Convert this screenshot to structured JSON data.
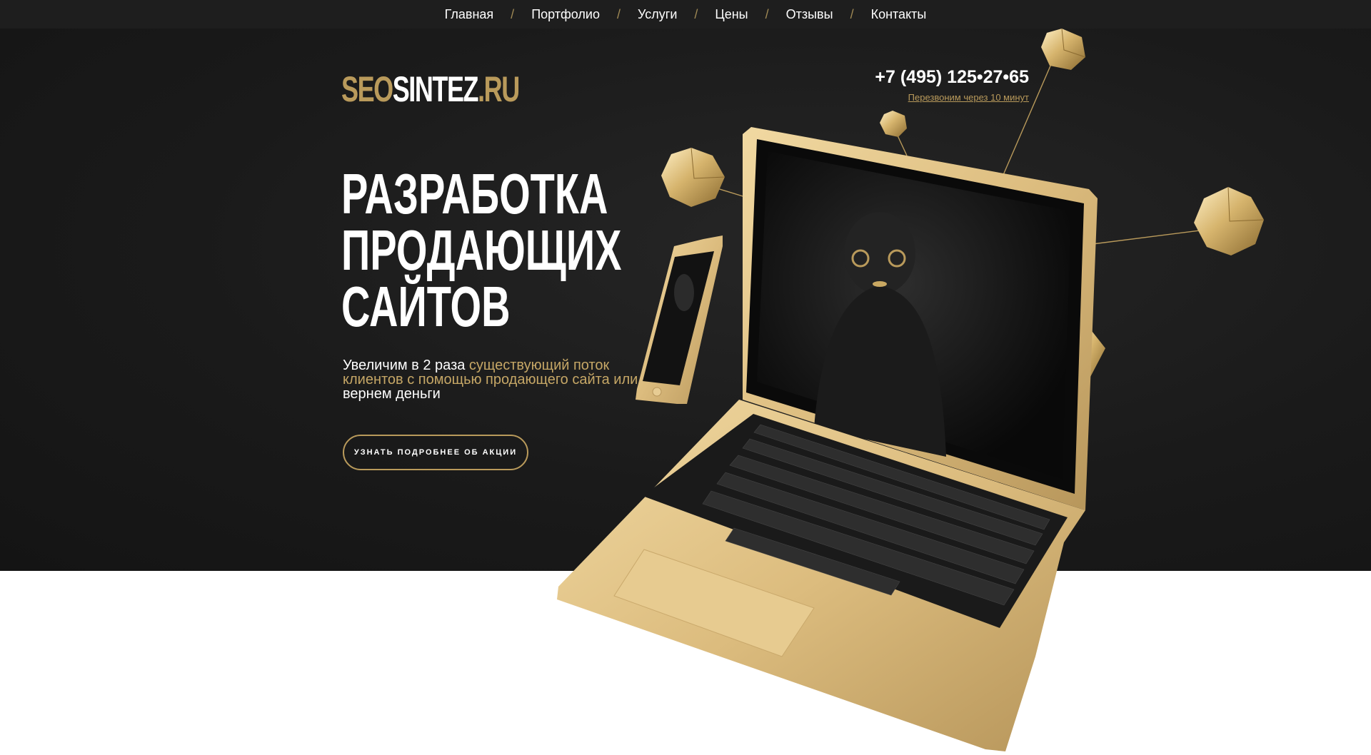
{
  "nav": {
    "items": [
      "Главная",
      "Портфолио",
      "Услуги",
      "Цены",
      "Отзывы",
      "Контакты"
    ],
    "separator": "/"
  },
  "logo": {
    "part1": "SEO",
    "part2": "SINTEZ",
    "part3": ".RU"
  },
  "contact": {
    "phone": "+7 (495) 125•27•65",
    "callback": "Перезвоним через 10 минут"
  },
  "hero": {
    "headline": [
      "РАЗРАБОТКА",
      "ПРОДАЮЩИХ",
      "САЙТОВ"
    ],
    "sub": {
      "s1": "Увеличим в 2 раза ",
      "s2": "существующий поток клиентов с помощью продающего сайта или ",
      "s3": "вернем деньги"
    },
    "cta": "УЗНАТЬ ПОДРОБНЕЕ ОБ АКЦИИ"
  },
  "colors": {
    "accent_gold": "#b99a5b",
    "dark_bg": "#1a1a1a",
    "nav_bg": "#1e1e1e"
  },
  "icons": [
    "laptop-image",
    "smartphone-image",
    "gold-polyhedron-icon"
  ]
}
